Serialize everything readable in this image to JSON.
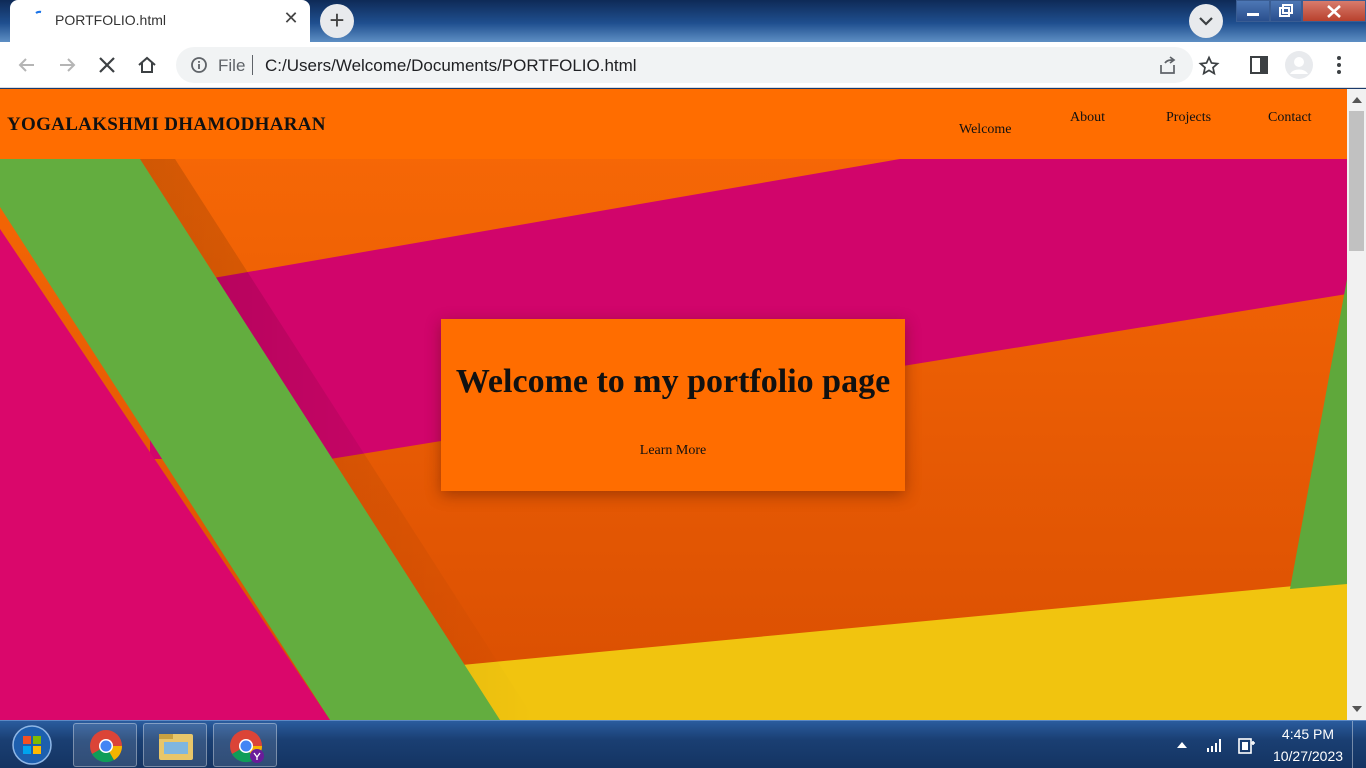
{
  "browser": {
    "tab_title": "PORTFOLIO.html",
    "tab_close": "✕",
    "new_tab": "+",
    "omnibox_scheme": "File",
    "url": "C:/Users/Welcome/Documents/PORTFOLIO.html"
  },
  "site": {
    "logo": "YOGALAKSHMI DHAMODHARAN",
    "nav": [
      "Welcome",
      "About",
      "Projects",
      "Contact"
    ],
    "hero_title": "Welcome to my portfolio page",
    "hero_cta": "Learn More"
  },
  "taskbar": {
    "time": "4:45 PM",
    "date": "10/27/2023"
  },
  "colors": {
    "nav_bg": "#ff6d00",
    "magenta": "#d9066b",
    "green": "#62ad3e",
    "yellow": "#f1c40f",
    "orange": "#f25c05"
  },
  "icons": [
    "back-icon",
    "forward-icon",
    "stop-icon",
    "home-icon",
    "info-icon",
    "share-icon",
    "star-icon",
    "sidepanel-icon",
    "profile-icon",
    "menu-icon",
    "chrome-icon",
    "explorer-icon",
    "network-icon",
    "power-icon"
  ]
}
